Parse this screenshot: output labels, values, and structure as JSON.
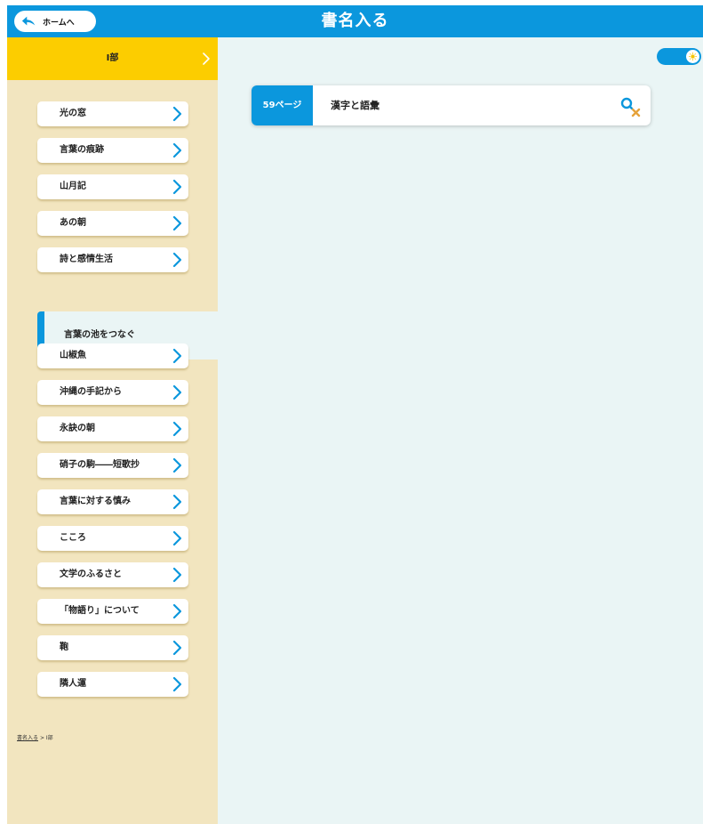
{
  "header": {
    "title": "書名入る",
    "home_label": "ホームへ"
  },
  "sidebar": {
    "part_label": "Ⅰ部",
    "items": [
      {
        "label": "光の窓"
      },
      {
        "label": "言葉の痕跡"
      },
      {
        "label": "山月記"
      },
      {
        "label": "あの朝"
      },
      {
        "label": "詩と感情生活"
      },
      {
        "label": "言葉の池をつなぐ",
        "active": true
      },
      {
        "label": "山椒魚"
      },
      {
        "label": "沖縄の手記から"
      },
      {
        "label": "永訣の朝"
      },
      {
        "label": "硝子の駒――短歌抄"
      },
      {
        "label": "言葉に対する慎み"
      },
      {
        "label": "こころ"
      },
      {
        "label": "文学のふるさと"
      },
      {
        "label": "「物語り」について"
      },
      {
        "label": "鞄"
      },
      {
        "label": "隣人運"
      }
    ]
  },
  "breadcrumb": {
    "link": "書名入る",
    "separator": ">",
    "current": "Ⅰ部"
  },
  "main": {
    "toggle_on": true,
    "page_card": {
      "page": "59ページ",
      "title": "漢字と語彙"
    }
  },
  "colors": {
    "accent": "#0b97dd",
    "part_header": "#fccd00",
    "sidebar_bg": "#f2e5bf",
    "content_bg": "#eaf5f5",
    "icon_orange": "#e6a23a"
  },
  "icons": {
    "home": "back-arrow-icon",
    "chevron": "chevron-right-icon",
    "toggle": "sun-icon",
    "card": "search-x-icon"
  }
}
